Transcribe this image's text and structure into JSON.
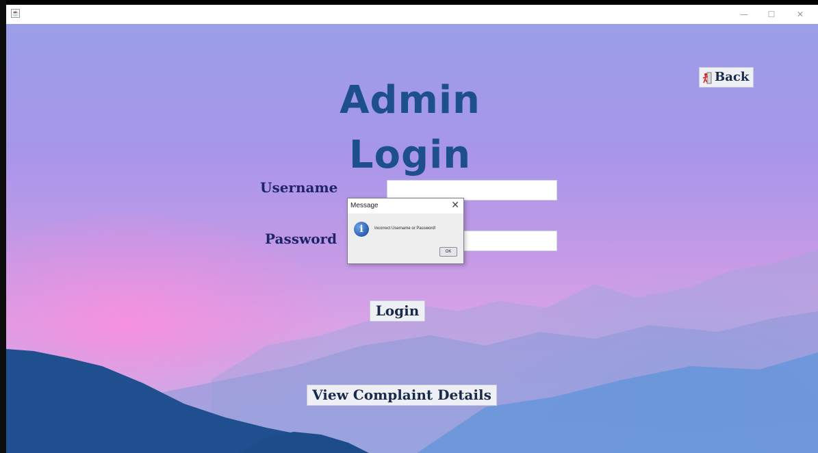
{
  "window": {
    "minimize_glyph": "—",
    "maximize_glyph": "☐",
    "close_glyph": "✕",
    "app_icon": "java-icon"
  },
  "page": {
    "title": "Admin Login",
    "back_label": "Back",
    "back_icon": "exit-door-icon"
  },
  "form": {
    "username_label": "Username",
    "username_value": "",
    "password_label": "Password",
    "password_value": "",
    "login_label": "Login",
    "view_complaints_label": "View Complaint Details"
  },
  "dialog": {
    "title": "Message",
    "message": "Incorrect Username or Password!",
    "ok_label": "OK",
    "icon": "info-icon"
  },
  "colors": {
    "title": "#1d4f8c",
    "labels": "#1e2469",
    "dialog_info": "#2c5fb0"
  }
}
